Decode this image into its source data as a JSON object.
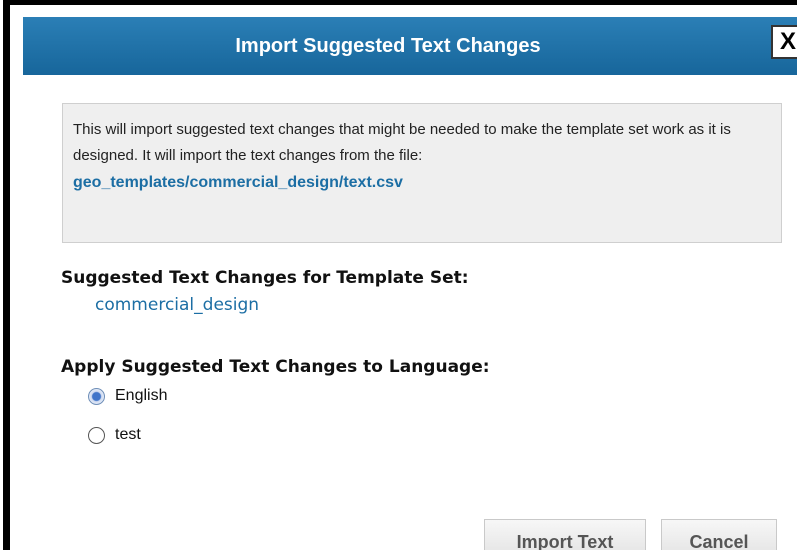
{
  "dialog": {
    "title": "Import Suggested Text Changes",
    "close_label": "X"
  },
  "info": {
    "text": "This will import suggested text changes that might be needed to make the template set work as it is designed. It will import the text changes from the file:",
    "file_path": "geo_templates/commercial_design/text.csv"
  },
  "template_set": {
    "heading": "Suggested Text Changes for Template Set:",
    "name": "commercial_design"
  },
  "language": {
    "heading": "Apply Suggested Text Changes to Language:",
    "options": [
      {
        "label": "English",
        "selected": true
      },
      {
        "label": "test",
        "selected": false
      }
    ]
  },
  "buttons": {
    "import_label": "Import Text",
    "cancel_label": "Cancel"
  },
  "colors": {
    "titlebar": "#1a6fa6",
    "link": "#1c6ea4",
    "info_background": "#efefef"
  }
}
